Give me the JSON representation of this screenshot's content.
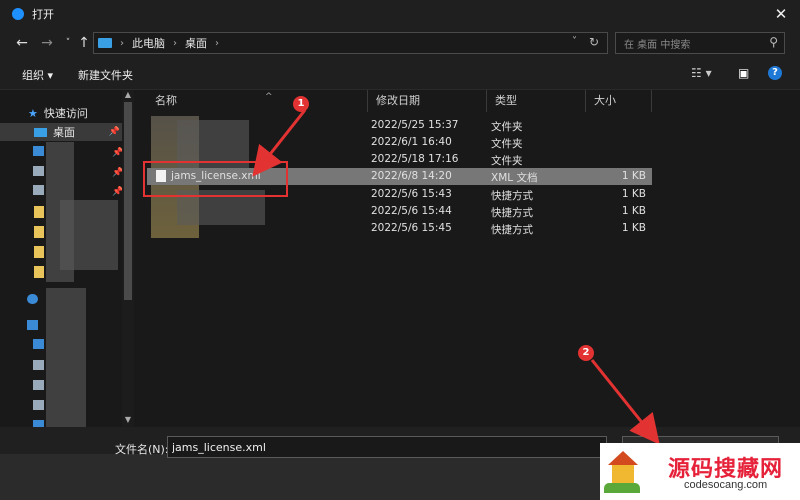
{
  "window": {
    "title": "打开"
  },
  "address": {
    "crumbs": [
      "此电脑",
      "桌面"
    ]
  },
  "search": {
    "placeholder": "在 桌面 中搜索"
  },
  "toolbar": {
    "organize": "组织 ▾",
    "new_folder": "新建文件夹"
  },
  "sidebar": {
    "quick_access": "快速访问",
    "desktop": "桌面"
  },
  "columns": {
    "name": "名称",
    "date": "修改日期",
    "type": "类型",
    "size": "大小"
  },
  "files": [
    {
      "name": "",
      "date": "2022/5/25 15:37",
      "type": "文件夹",
      "size": ""
    },
    {
      "name": "",
      "date": "2022/6/1 16:40",
      "type": "文件夹",
      "size": ""
    },
    {
      "name": "",
      "date": "2022/5/18 17:16",
      "type": "文件夹",
      "size": ""
    },
    {
      "name": "jams_license.xml",
      "date": "2022/6/8 14:20",
      "type": "XML 文档",
      "size": "1 KB"
    },
    {
      "name": "",
      "date": "2022/5/6 15:43",
      "type": "快捷方式",
      "size": "1 KB"
    },
    {
      "name": "",
      "date": "2022/5/6 15:44",
      "type": "快捷方式",
      "size": "1 KB"
    },
    {
      "name": "",
      "date": "2022/5/6 15:45",
      "type": "快捷方式",
      "size": "1 KB"
    }
  ],
  "bottom": {
    "filename_label": "文件名(N):",
    "filename_value": "jams_license.xml"
  },
  "annotations": {
    "badge1": "1",
    "badge2": "2"
  },
  "watermark": {
    "title": "源码搜藏网",
    "url": "codesocang.com"
  },
  "colors": {
    "annotation_red": "#e23232",
    "selected_row": "#777777",
    "accent_blue": "#1e90ff"
  }
}
